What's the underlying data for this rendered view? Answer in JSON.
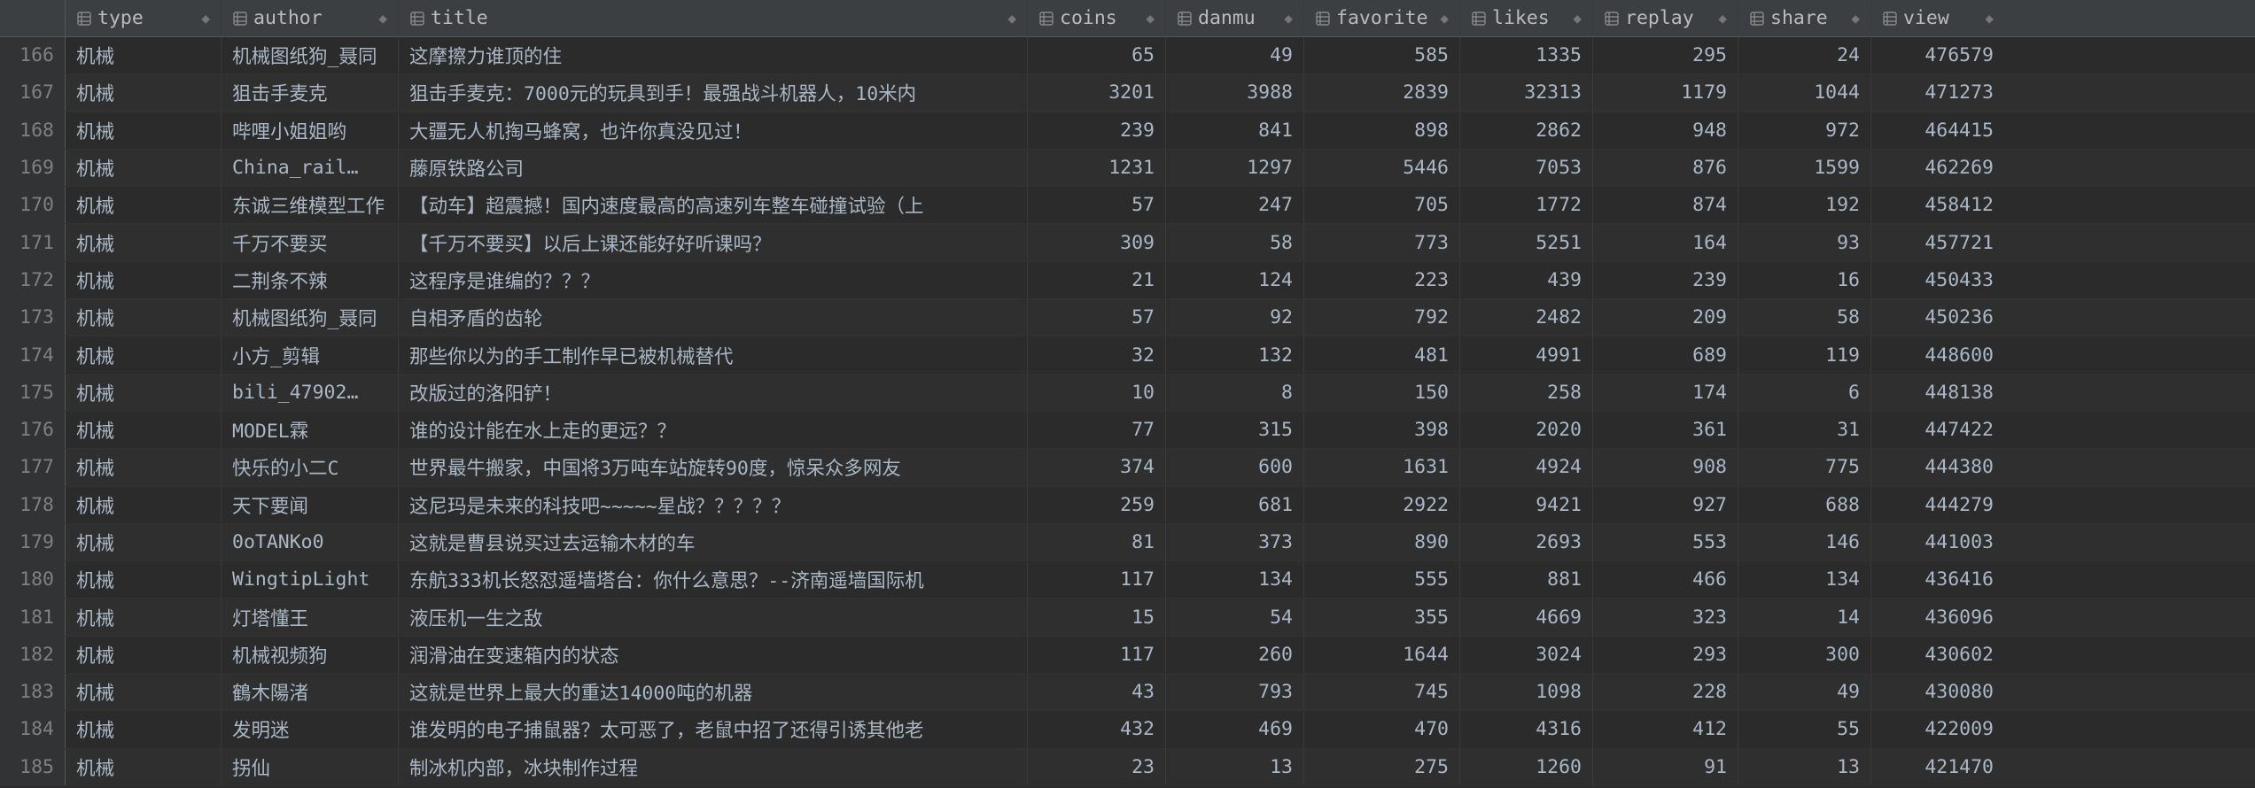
{
  "columns": {
    "type": "type",
    "author": "author",
    "title": "title",
    "coins": "coins",
    "danmu": "danmu",
    "favorite": "favorite",
    "likes": "likes",
    "replay": "replay",
    "share": "share",
    "view": "view"
  },
  "sort_glyph": "◆",
  "rows": [
    {
      "n": 166,
      "type": "机械",
      "author": "机械图纸狗_聂同",
      "title": "这摩擦力谁顶的住",
      "coins": 65,
      "danmu": 49,
      "favorite": 585,
      "likes": 1335,
      "replay": 295,
      "share": 24,
      "view": 476579
    },
    {
      "n": 167,
      "type": "机械",
      "author": "狙击手麦克",
      "title": "狙击手麦克：7000元的玩具到手！最强战斗机器人，10米内",
      "coins": 3201,
      "danmu": 3988,
      "favorite": 2839,
      "likes": 32313,
      "replay": 1179,
      "share": 1044,
      "view": 471273
    },
    {
      "n": 168,
      "type": "机械",
      "author": "哔哩小姐姐哟",
      "title": "大疆无人机掏马蜂窝，也许你真没见过！",
      "coins": 239,
      "danmu": 841,
      "favorite": 898,
      "likes": 2862,
      "replay": 948,
      "share": 972,
      "view": 464415
    },
    {
      "n": 169,
      "type": "机械",
      "author": "China_rail…",
      "title": "藤原铁路公司",
      "coins": 1231,
      "danmu": 1297,
      "favorite": 5446,
      "likes": 7053,
      "replay": 876,
      "share": 1599,
      "view": 462269
    },
    {
      "n": 170,
      "type": "机械",
      "author": "东诚三维模型工作",
      "title": "【动车】超震撼！国内速度最高的高速列车整车碰撞试验（上",
      "coins": 57,
      "danmu": 247,
      "favorite": 705,
      "likes": 1772,
      "replay": 874,
      "share": 192,
      "view": 458412
    },
    {
      "n": 171,
      "type": "机械",
      "author": "千万不要买",
      "title": "【千万不要买】以后上课还能好好听课吗？",
      "coins": 309,
      "danmu": 58,
      "favorite": 773,
      "likes": 5251,
      "replay": 164,
      "share": 93,
      "view": 457721
    },
    {
      "n": 172,
      "type": "机械",
      "author": "二荆条不辣",
      "title": "这程序是谁编的？？？",
      "coins": 21,
      "danmu": 124,
      "favorite": 223,
      "likes": 439,
      "replay": 239,
      "share": 16,
      "view": 450433
    },
    {
      "n": 173,
      "type": "机械",
      "author": "机械图纸狗_聂同",
      "title": "自相矛盾的齿轮",
      "coins": 57,
      "danmu": 92,
      "favorite": 792,
      "likes": 2482,
      "replay": 209,
      "share": 58,
      "view": 450236
    },
    {
      "n": 174,
      "type": "机械",
      "author": "小方_剪辑",
      "title": "那些你以为的手工制作早已被机械替代",
      "coins": 32,
      "danmu": 132,
      "favorite": 481,
      "likes": 4991,
      "replay": 689,
      "share": 119,
      "view": 448600
    },
    {
      "n": 175,
      "type": "机械",
      "author": "bili_47902…",
      "title": "改版过的洛阳铲！",
      "coins": 10,
      "danmu": 8,
      "favorite": 150,
      "likes": 258,
      "replay": 174,
      "share": 6,
      "view": 448138
    },
    {
      "n": 176,
      "type": "机械",
      "author": "MODEL霖",
      "title": "谁的设计能在水上走的更远？？",
      "coins": 77,
      "danmu": 315,
      "favorite": 398,
      "likes": 2020,
      "replay": 361,
      "share": 31,
      "view": 447422
    },
    {
      "n": 177,
      "type": "机械",
      "author": "快乐的小二C",
      "title": "世界最牛搬家，中国将3万吨车站旋转90度，惊呆众多网友",
      "coins": 374,
      "danmu": 600,
      "favorite": 1631,
      "likes": 4924,
      "replay": 908,
      "share": 775,
      "view": 444380
    },
    {
      "n": 178,
      "type": "机械",
      "author": "天下要闻",
      "title": "这尼玛是未来的科技吧~~~~~星战？？？？？",
      "coins": 259,
      "danmu": 681,
      "favorite": 2922,
      "likes": 9421,
      "replay": 927,
      "share": 688,
      "view": 444279
    },
    {
      "n": 179,
      "type": "机械",
      "author": "0oTANKo0",
      "title": "这就是曹县说买过去运输木材的车",
      "coins": 81,
      "danmu": 373,
      "favorite": 890,
      "likes": 2693,
      "replay": 553,
      "share": 146,
      "view": 441003
    },
    {
      "n": 180,
      "type": "机械",
      "author": "WingtipLight",
      "title": "东航333机长怒怼遥墙塔台：你什么意思？--济南遥墙国际机",
      "coins": 117,
      "danmu": 134,
      "favorite": 555,
      "likes": 881,
      "replay": 466,
      "share": 134,
      "view": 436416
    },
    {
      "n": 181,
      "type": "机械",
      "author": "灯塔懂王",
      "title": "液压机一生之敌",
      "coins": 15,
      "danmu": 54,
      "favorite": 355,
      "likes": 4669,
      "replay": 323,
      "share": 14,
      "view": 436096
    },
    {
      "n": 182,
      "type": "机械",
      "author": "机械视频狗",
      "title": "润滑油在变速箱内的状态",
      "coins": 117,
      "danmu": 260,
      "favorite": 1644,
      "likes": 3024,
      "replay": 293,
      "share": 300,
      "view": 430602
    },
    {
      "n": 183,
      "type": "机械",
      "author": "鶴木陽渚",
      "title": "这就是世界上最大的重达14000吨的机器",
      "coins": 43,
      "danmu": 793,
      "favorite": 745,
      "likes": 1098,
      "replay": 228,
      "share": 49,
      "view": 430080
    },
    {
      "n": 184,
      "type": "机械",
      "author": "发明迷",
      "title": "谁发明的电子捕鼠器？太可恶了，老鼠中招了还得引诱其他老",
      "coins": 432,
      "danmu": 469,
      "favorite": 470,
      "likes": 4316,
      "replay": 412,
      "share": 55,
      "view": 422009
    },
    {
      "n": 185,
      "type": "机械",
      "author": "拐仙",
      "title": "制冰机内部，冰块制作过程",
      "coins": 23,
      "danmu": 13,
      "favorite": 275,
      "likes": 1260,
      "replay": 91,
      "share": 13,
      "view": 421470
    }
  ]
}
